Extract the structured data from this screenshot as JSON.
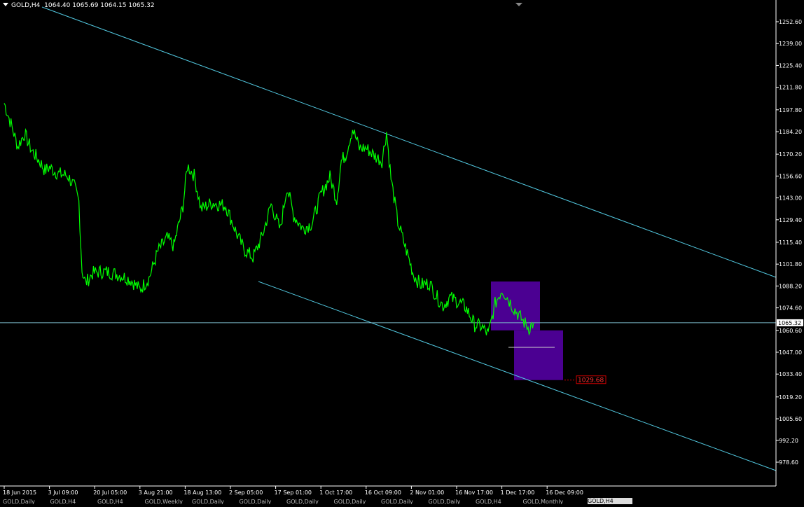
{
  "window": {
    "symbol": "GOLD",
    "timeframe": "H4",
    "ohlc": "1064.40 1065.69 1064.15 1065.32"
  },
  "colors": {
    "background": "#000000",
    "candles": "#00ff00",
    "trendline": "#52c8e0",
    "price_line": "#7ab6c8",
    "zone": "#4b0092",
    "target_label_bg": "#cc0000",
    "axis": "#ffffff"
  },
  "price_axis": {
    "ticks": [
      "1252.60",
      "1239.00",
      "1225.40",
      "1211.80",
      "1197.80",
      "1184.20",
      "1170.20",
      "1156.60",
      "1143.00",
      "1129.40",
      "1115.40",
      "1101.80",
      "1088.20",
      "1074.60",
      "1060.60",
      "1047.00",
      "1033.40",
      "1019.20",
      "1005.60",
      "992.20",
      "978.60"
    ],
    "current_price": "1065.32",
    "target_price": "1029.68"
  },
  "time_axis": {
    "labels": [
      "18 Jun 2015",
      "3 Jul 09:00",
      "20 Jul 05:00",
      "3 Aug 21:00",
      "18 Aug 13:00",
      "2 Sep 05:00",
      "17 Sep 01:00",
      "1 Oct 17:00",
      "16 Oct 09:00",
      "2 Nov 01:00",
      "16 Nov 17:00",
      "1 Dec 17:00",
      "16 Dec 09:00"
    ]
  },
  "tabs": [
    {
      "label": "GOLD,Daily",
      "active": false
    },
    {
      "label": "GOLD,H4",
      "active": false
    },
    {
      "label": "GOLD,H4",
      "active": false
    },
    {
      "label": "GOLD,Weekly",
      "active": false
    },
    {
      "label": "GOLD,Daily",
      "active": false
    },
    {
      "label": "GOLD,Daily",
      "active": false
    },
    {
      "label": "GOLD,Daily",
      "active": false
    },
    {
      "label": "GOLD,Daily",
      "active": false
    },
    {
      "label": "GOLD,Daily",
      "active": false
    },
    {
      "label": "GOLD,Daily",
      "active": false
    },
    {
      "label": "GOLD,H4",
      "active": false
    },
    {
      "label": "GOLD,Monthly",
      "active": false
    },
    {
      "label": "GOLD,H4",
      "active": true
    }
  ],
  "chart_data": {
    "type": "line",
    "title": "GOLD,H4",
    "ylim": [
      974.0,
      1262.0
    ],
    "x_labels": [
      "18 Jun 2015",
      "3 Jul 09:00",
      "20 Jul 05:00",
      "3 Aug 21:00",
      "18 Aug 13:00",
      "2 Sep 05:00",
      "17 Sep 01:00",
      "1 Oct 17:00",
      "16 Oct 09:00",
      "2 Nov 01:00",
      "16 Nov 17:00",
      "1 Dec 17:00",
      "16 Dec 09:00"
    ],
    "series": [
      {
        "values_by_label_index": [
          [
            0,
            1202
          ],
          [
            0.15,
            1189
          ],
          [
            0.3,
            1175
          ],
          [
            0.45,
            1183
          ],
          [
            0.6,
            1173
          ],
          [
            0.8,
            1165
          ],
          [
            0.9,
            1160
          ],
          [
            1.0,
            1162
          ],
          [
            1.2,
            1158
          ],
          [
            1.4,
            1157
          ],
          [
            1.55,
            1150
          ],
          [
            1.65,
            1141
          ],
          [
            1.72,
            1098
          ],
          [
            1.8,
            1090
          ],
          [
            1.95,
            1096
          ],
          [
            2.1,
            1097
          ],
          [
            2.3,
            1097
          ],
          [
            2.55,
            1095
          ],
          [
            2.8,
            1092
          ],
          [
            3.0,
            1086
          ],
          [
            3.2,
            1093
          ],
          [
            3.4,
            1110
          ],
          [
            3.6,
            1118
          ],
          [
            3.75,
            1113
          ],
          [
            3.95,
            1138
          ],
          [
            4.05,
            1163
          ],
          [
            4.2,
            1157
          ],
          [
            4.35,
            1136
          ],
          [
            4.6,
            1140
          ],
          [
            4.9,
            1138
          ],
          [
            5.15,
            1120
          ],
          [
            5.3,
            1111
          ],
          [
            5.5,
            1106
          ],
          [
            5.7,
            1119
          ],
          [
            5.9,
            1139
          ],
          [
            6.1,
            1123
          ],
          [
            6.25,
            1150
          ],
          [
            6.4,
            1132
          ],
          [
            6.6,
            1124
          ],
          [
            6.8,
            1127
          ],
          [
            7.0,
            1145
          ],
          [
            7.2,
            1156
          ],
          [
            7.35,
            1142
          ],
          [
            7.45,
            1166
          ],
          [
            7.55,
            1170
          ],
          [
            7.7,
            1186
          ],
          [
            7.85,
            1174
          ],
          [
            8.0,
            1174
          ],
          [
            8.2,
            1169
          ],
          [
            8.35,
            1166
          ],
          [
            8.45,
            1184
          ],
          [
            8.55,
            1155
          ],
          [
            8.7,
            1128
          ],
          [
            8.85,
            1114
          ],
          [
            9.05,
            1095
          ],
          [
            9.2,
            1089
          ],
          [
            9.4,
            1090
          ],
          [
            9.55,
            1082
          ],
          [
            9.7,
            1076
          ],
          [
            9.85,
            1081
          ],
          [
            10.0,
            1079
          ],
          [
            10.2,
            1075
          ],
          [
            10.4,
            1064
          ],
          [
            10.55,
            1063
          ],
          [
            10.7,
            1058
          ],
          [
            10.85,
            1077
          ],
          [
            11.0,
            1086
          ],
          [
            11.1,
            1082
          ],
          [
            11.25,
            1075
          ],
          [
            11.45,
            1067
          ],
          [
            11.6,
            1062
          ],
          [
            11.7,
            1065.32
          ]
        ]
      }
    ],
    "annotations": {
      "upper_trendline": "falling channel top",
      "lower_trendline": "falling channel bottom",
      "horizontal_line": "1065.32",
      "zone_upper": [
        1060.6,
        1091.0
      ],
      "zone_lower": [
        1029.68,
        1060.6
      ],
      "target_label": "1029.68"
    }
  }
}
